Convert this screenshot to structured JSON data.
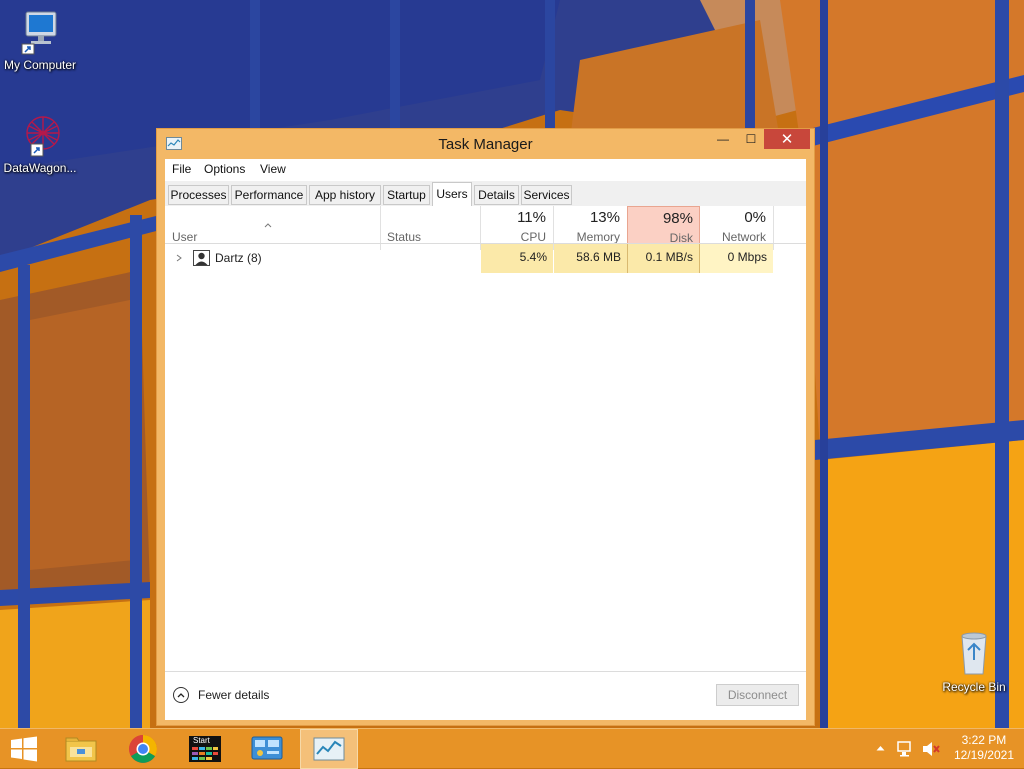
{
  "desktop": {
    "icons": [
      {
        "label": "My Computer"
      },
      {
        "label": "DataWagon..."
      },
      {
        "label": "Recycle Bin"
      }
    ]
  },
  "window": {
    "title": "Task Manager",
    "min_glyph": "—",
    "max_glyph": "☐",
    "close_glyph": "✕"
  },
  "menu": [
    "File",
    "Options",
    "View"
  ],
  "tabs": [
    {
      "label": "Processes"
    },
    {
      "label": "Performance"
    },
    {
      "label": "App history"
    },
    {
      "label": "Startup"
    },
    {
      "label": "Users",
      "active": true
    },
    {
      "label": "Details"
    },
    {
      "label": "Services"
    }
  ],
  "table": {
    "columns": {
      "user": "User",
      "status": "Status",
      "cpu": {
        "label": "CPU",
        "pct": "11%"
      },
      "memory": {
        "label": "Memory",
        "pct": "13%"
      },
      "disk": {
        "label": "Disk",
        "pct": "98%"
      },
      "network": {
        "label": "Network",
        "pct": "0%"
      }
    },
    "rows": [
      {
        "user": "Dartz (8)",
        "status": "",
        "cpu": "5.4%",
        "memory": "58.6 MB",
        "disk": "0.1 MB/s",
        "network": "0 Mbps"
      }
    ]
  },
  "footer": {
    "fewer_details": "Fewer details",
    "disconnect": "Disconnect"
  },
  "taskbar": {
    "start_tile_label": "Start",
    "time": "3:22 PM",
    "date": "12/19/2021"
  },
  "icons": {
    "start": "windows-logo-icon",
    "explorer": "file-explorer-icon",
    "chrome": "chrome-icon",
    "start_tile": "start-menu-app-icon",
    "control_panel": "control-panel-icon",
    "task_manager": "task-manager-icon"
  },
  "colors": {
    "heat_light": "#fff4c4",
    "heat_mid": "#fbe9a9",
    "heat_high": "#f8c7b8",
    "disk_header": "#fbd0c4",
    "titlebar": "#f3b866",
    "close": "#c8473b"
  }
}
